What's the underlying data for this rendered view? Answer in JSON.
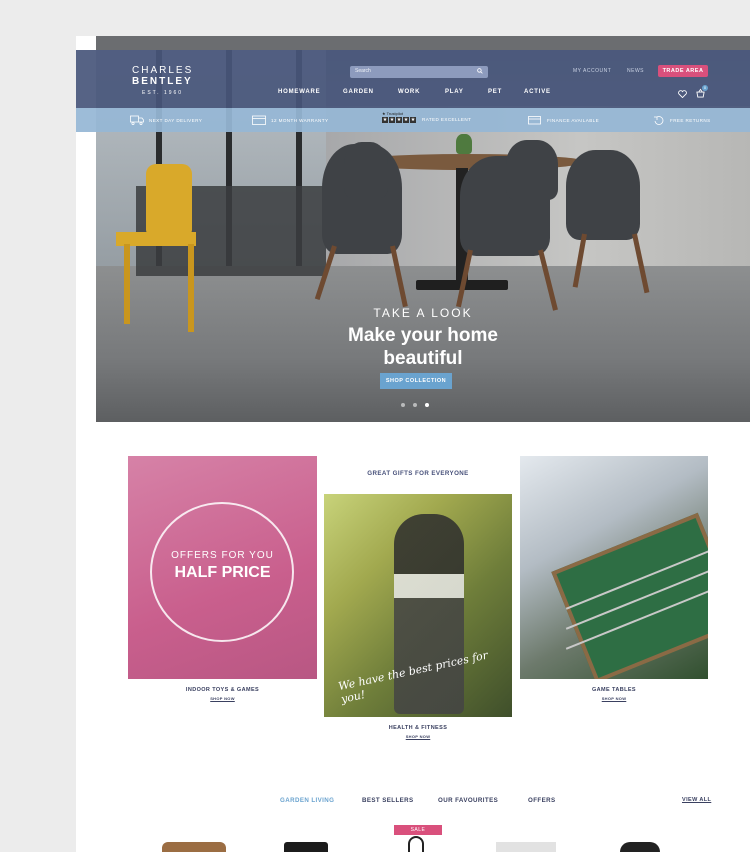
{
  "brand": {
    "line1": "CHARLES",
    "line2": "BENTLEY",
    "est": "EST. 1960"
  },
  "search": {
    "placeholder": "Search"
  },
  "top_links": {
    "account": "MY ACCOUNT",
    "news": "NEWS",
    "trade": "TRADE AREA"
  },
  "nav": [
    "HOMEWARE",
    "GARDEN",
    "WORK",
    "PLAY",
    "PET",
    "ACTIVE"
  ],
  "cart": {
    "count": "0"
  },
  "usp": {
    "delivery": "NEXT DAY DELIVERY",
    "warranty": "12 MONTH WARRANTY",
    "trustpilot_logo": "★ Trustpilot",
    "rated": "RATED EXCELLENT",
    "finance": "FINANCE AVAILABLE",
    "returns": "FREE RETURNS"
  },
  "hero": {
    "eyebrow": "TAKE A LOOK",
    "title_line1": "Make your home",
    "title_line2": "beautiful",
    "button": "SHOP COLLECTION",
    "slides_total": 3,
    "slide_active": 3
  },
  "gifts": {
    "title": "GREAT GIFTS FOR EVERYONE",
    "promo": {
      "eyebrow": "OFFERS FOR YOU",
      "title": "HALF PRICE"
    },
    "cards": [
      {
        "label": "INDOOR TOYS & GAMES",
        "link": "SHOP NOW"
      },
      {
        "label": "HEALTH & FITNESS",
        "link": "SHOP NOW",
        "script": "We have the best prices for you!"
      },
      {
        "label": "GAME TABLES",
        "link": "SHOP NOW"
      }
    ]
  },
  "product_tabs": {
    "tabs": [
      "GARDEN LIVING",
      "BEST SELLERS",
      "OUR FAVOURITES",
      "OFFERS"
    ],
    "active": "GARDEN LIVING",
    "view_all": "VIEW ALL",
    "sale_badge": "SALE"
  },
  "colors": {
    "header": "#48567b",
    "accent_blue": "#6aa3cf",
    "accent_pink": "#d9507c",
    "promo_pink": "#c95f8d"
  }
}
